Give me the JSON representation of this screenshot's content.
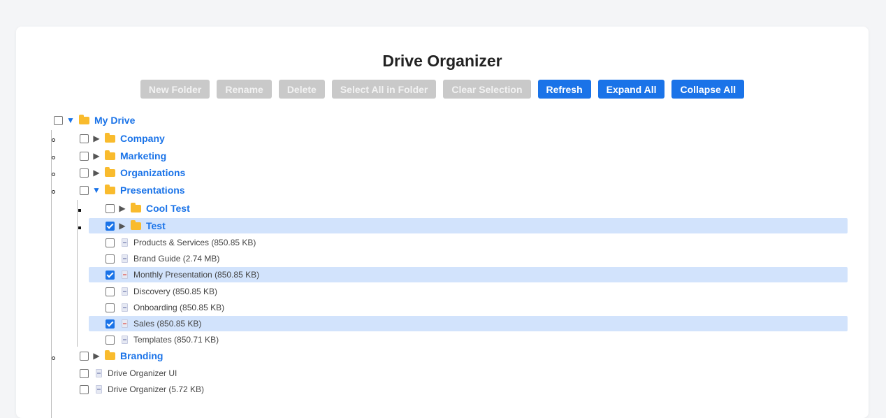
{
  "app": {
    "title": "Drive Organizer"
  },
  "toolbar": {
    "new_folder": "New Folder",
    "rename": "Rename",
    "delete": "Delete",
    "select_all": "Select All in Folder",
    "clear_selection": "Clear Selection",
    "refresh": "Refresh",
    "expand_all": "Expand All",
    "collapse_all": "Collapse All"
  },
  "colors": {
    "accent": "#1a73e8",
    "highlight": "#d2e3fc",
    "disabled": "#c9c9c9",
    "folder": "#f9bb2d"
  },
  "tree": {
    "root": {
      "name": "My Drive",
      "checked": false,
      "expanded": true,
      "icon": "folder-icon"
    },
    "company": {
      "name": "Company",
      "checked": false,
      "expanded": false
    },
    "marketing": {
      "name": "Marketing",
      "checked": false,
      "expanded": false
    },
    "organizations": {
      "name": "Organizations",
      "checked": false,
      "expanded": false
    },
    "presentations": {
      "name": "Presentations",
      "checked": false,
      "expanded": true,
      "cool_test": {
        "name": "Cool Test",
        "checked": false,
        "expanded": false
      },
      "test": {
        "name": "Test",
        "checked": true,
        "expanded": false
      },
      "files": [
        {
          "label": "Products & Services (850.85 KB)",
          "checked": false
        },
        {
          "label": "Brand Guide (2.74 MB)",
          "checked": false
        },
        {
          "label": "Monthly Presentation (850.85 KB)",
          "checked": true
        },
        {
          "label": "Discovery (850.85 KB)",
          "checked": false
        },
        {
          "label": "Onboarding (850.85 KB)",
          "checked": false
        },
        {
          "label": "Sales (850.85 KB)",
          "checked": true
        },
        {
          "label": "Templates (850.71 KB)",
          "checked": false
        }
      ]
    },
    "branding": {
      "name": "Branding",
      "checked": false,
      "expanded": false
    },
    "root_files": [
      {
        "label": "Drive Organizer UI",
        "checked": false
      },
      {
        "label": "Drive Organizer (5.72 KB)",
        "checked": false
      }
    ]
  }
}
